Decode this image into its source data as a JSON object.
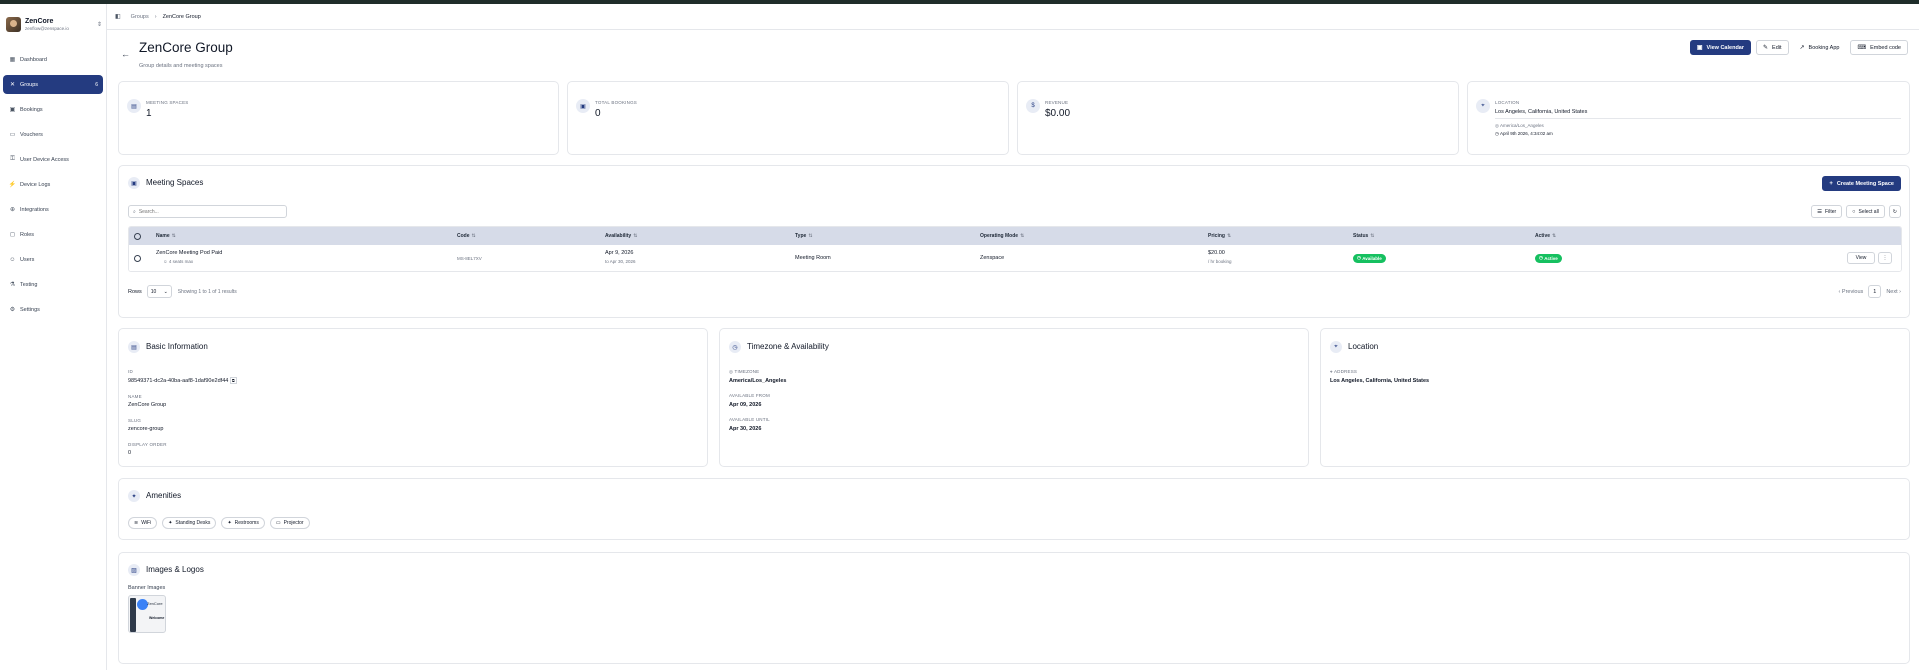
{
  "sidebar": {
    "brand_name": "ZenCore",
    "brand_email": "zenflow@zenspace.io",
    "items": [
      {
        "label": "Dashboard",
        "icon": "grid-icon"
      },
      {
        "label": "Groups",
        "icon": "groups-icon",
        "badge": "6",
        "active": true
      },
      {
        "label": "Bookings",
        "icon": "calendar-icon"
      },
      {
        "label": "Vouchers",
        "icon": "ticket-icon"
      },
      {
        "label": "User Device Access",
        "icon": "user-key-icon"
      },
      {
        "label": "Device Logs",
        "icon": "activity-icon"
      },
      {
        "label": "Integrations",
        "icon": "plug-icon"
      },
      {
        "label": "Roles",
        "icon": "shield-icon"
      },
      {
        "label": "Users",
        "icon": "users-icon"
      },
      {
        "label": "Testing",
        "icon": "flask-icon"
      },
      {
        "label": "Settings",
        "icon": "gear-icon"
      }
    ]
  },
  "breadcrumb": {
    "root": "Groups",
    "current": "ZenCore Group"
  },
  "header": {
    "title": "ZenCore Group",
    "subtitle": "Group details and meeting spaces",
    "actions": {
      "view_calendar": "View Calendar",
      "edit": "Edit",
      "booking_app": "Booking App",
      "embed_code": "Embed code"
    }
  },
  "stats": {
    "meeting_spaces": {
      "label": "MEETING SPACES",
      "value": "1"
    },
    "total_bookings": {
      "label": "TOTAL BOOKINGS",
      "value": "0"
    },
    "revenue": {
      "label": "REVENUE",
      "value": "$0.00"
    },
    "location": {
      "label": "LOCATION",
      "value": "Los Angeles, California, United States",
      "timezone": "America/Los_Angeles",
      "datetime": "April 9th 2026, 4:34:02 am"
    }
  },
  "meeting_spaces": {
    "title": "Meeting Spaces",
    "create_label": "Create Meeting Space",
    "search_placeholder": "Search...",
    "filter_label": "Filter",
    "select_all_label": "Select all",
    "columns": [
      "Name",
      "Code",
      "Availability",
      "Type",
      "Operating Mode",
      "Pricing",
      "Status",
      "Active"
    ],
    "rows": [
      {
        "name": "ZenCore Meeting Pod Paid",
        "capacity": "4 seats max",
        "code": "MS-8EL7XV",
        "availability_from": "Apr 9, 2026",
        "availability_to": "to Apr 30, 2026",
        "type": "Meeting Room",
        "operating_mode": "Zenspace",
        "price": "$20.00",
        "price_unit": "/ hr booking",
        "status": "Available",
        "active": "Active",
        "view_label": "View"
      }
    ],
    "rows_label": "Rows",
    "rows_value": "10",
    "showing_text": "Showing 1 to 1 of 1 results",
    "prev_label": "Previous",
    "page": "1",
    "next_label": "Next"
  },
  "basic_info": {
    "title": "Basic Information",
    "id_label": "ID",
    "id_value": "98549371-dc2a-40ba-aaf8-1daf90e2df44",
    "name_label": "NAME",
    "name_value": "ZenCore Group",
    "slug_label": "SLUG",
    "slug_value": "zencore-group",
    "display_order_label": "DISPLAY ORDER",
    "display_order_value": "0"
  },
  "timezone_availability": {
    "title": "Timezone & Availability",
    "timezone_label": "TIMEZONE",
    "timezone_value": "America/Los_Angeles",
    "from_label": "AVAILABLE FROM",
    "from_value": "Apr 09, 2026",
    "until_label": "AVAILABLE UNTIL",
    "until_value": "Apr 30, 2026"
  },
  "location_card": {
    "title": "Location",
    "address_label": "ADDRESS",
    "address_value": "Los Angeles, California, United States"
  },
  "amenities": {
    "title": "Amenities",
    "items": [
      "WiFi",
      "Standing Desks",
      "Restrooms",
      "Projector"
    ]
  },
  "images": {
    "title": "Images & Logos",
    "banner_label": "Banner Images",
    "thumb_text": "ZenCore",
    "thumb_text2": "Welcome"
  }
}
